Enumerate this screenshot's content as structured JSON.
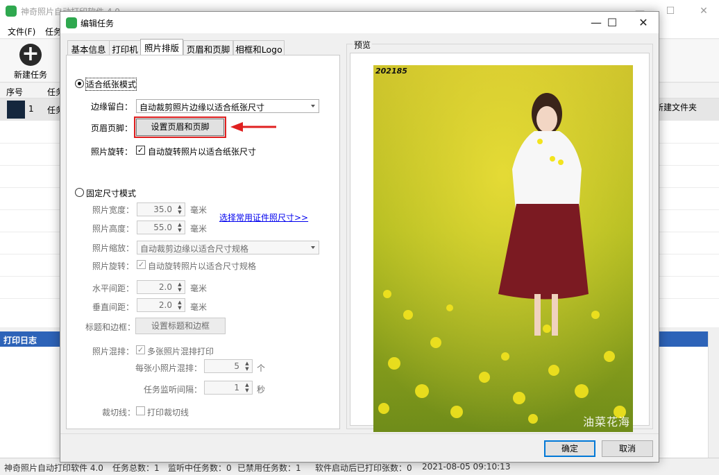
{
  "main_window": {
    "title": "神奇照片自动打印软件 4.0",
    "menus": [
      "文件(F)",
      "任务"
    ],
    "toolbar": {
      "new_task_label": "新建任务",
      "new_task_icon": "plus-circle-icon"
    },
    "table": {
      "headers": [
        "序号",
        "任务"
      ],
      "row": {
        "index": "1",
        "name": "任务",
        "right_text": "新建文件夹"
      }
    },
    "log_title": "打印日志",
    "status": {
      "app": "神奇照片自动打印软件 4.0",
      "total": "任务总数：1",
      "monitoring": "监听中任务数：0",
      "disabled": "已禁用任务数：1",
      "printed": "软件启动后已打印张数：0",
      "time": "2021-08-05 09:10:13"
    }
  },
  "dialog": {
    "title": "编辑任务",
    "tabs": [
      "基本信息",
      "打印机",
      "照片排版",
      "页眉和页脚",
      "相框和Logo"
    ],
    "active_tab": "照片排版",
    "fit_paper": {
      "mode_label": "适合纸张模式",
      "selected": true,
      "margin_label": "边缘留白：",
      "margin_value": "自动裁剪照片边缘以适合纸张尺寸",
      "header_footer_label": "页眉页脚：",
      "header_footer_button": "设置页眉和页脚",
      "rotate_label": "照片旋转：",
      "rotate_checkbox": "自动旋转照片以适合纸张尺寸",
      "rotate_checked": true
    },
    "fixed_size": {
      "mode_label": "固定尺寸模式",
      "selected": false,
      "width_label": "照片宽度：",
      "width_value": "35.0",
      "height_label": "照片高度：",
      "height_value": "55.0",
      "unit_mm": "毫米",
      "id_photo_link": "选择常用证件照尺寸>>",
      "scale_label": "照片缩放：",
      "scale_value": "自动裁剪边缘以适合尺寸规格",
      "rotate_label": "照片旋转：",
      "rotate_checkbox": "自动旋转照片以适合尺寸规格",
      "hspace_label": "水平间距：",
      "hspace_value": "2.0",
      "vspace_label": "垂直间距：",
      "vspace_value": "2.0",
      "title_border_label": "标题和边框：",
      "title_border_button": "设置标题和边框"
    },
    "mix": {
      "label": "照片混排：",
      "checkbox": "多张照片混排打印",
      "per_sheet_label": "每张小照片混排：",
      "per_sheet_value": "5",
      "per_sheet_unit": "个",
      "interval_label": "任务监听间隔：",
      "interval_value": "1",
      "interval_unit": "秒"
    },
    "cut_line": {
      "label": "裁切线：",
      "checkbox": "打印裁切线"
    },
    "preview": {
      "legend": "预览",
      "photo_tag": "202185",
      "watermark": "油菜花海"
    },
    "ok_label": "确定",
    "cancel_label": "取消"
  },
  "colors": {
    "accent_red": "#e02020",
    "log_header": "#2d63b8",
    "field_yellow": "#e2d21a"
  }
}
